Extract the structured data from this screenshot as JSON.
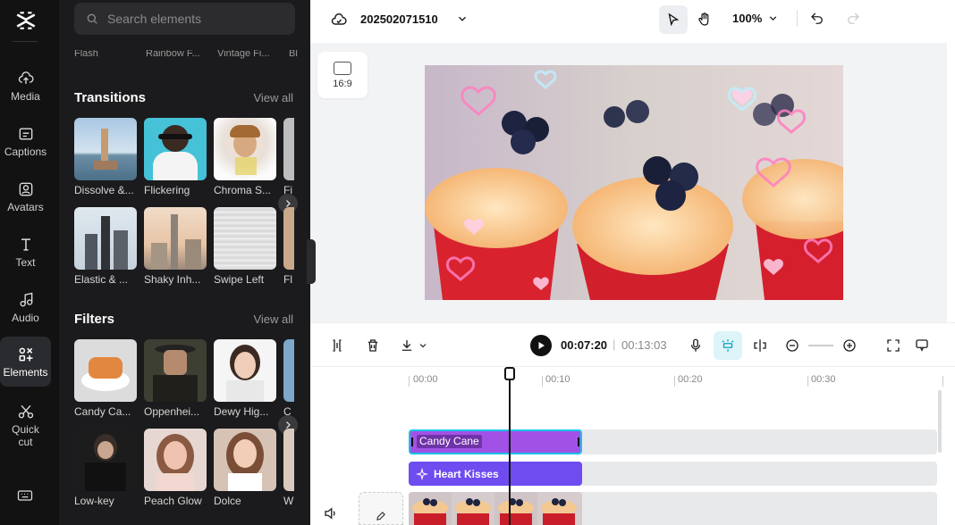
{
  "rail": {
    "items": [
      {
        "label": "Media",
        "icon": "cloud-upload-icon"
      },
      {
        "label": "Captions",
        "icon": "captions-icon"
      },
      {
        "label": "Avatars",
        "icon": "avatar-icon"
      },
      {
        "label": "Text",
        "icon": "text-icon"
      },
      {
        "label": "Audio",
        "icon": "music-icon"
      },
      {
        "label": "Elements",
        "icon": "elements-icon",
        "active": true
      },
      {
        "label": "Quick cut",
        "icon": "scissors-icon"
      }
    ]
  },
  "panel": {
    "search_placeholder": "Search elements",
    "cut_row": [
      "Flash",
      "Rainbow F...",
      "Vintage Fi...",
      "Bl"
    ],
    "transitions": {
      "title": "Transitions",
      "view_all": "View all",
      "row1": [
        "Dissolve &...",
        "Flickering",
        "Chroma S...",
        "Fi"
      ],
      "row2": [
        "Elastic & ...",
        "Shaky Inh...",
        "Swipe Left",
        "Fl"
      ]
    },
    "filters": {
      "title": "Filters",
      "view_all": "View all",
      "row1": [
        "Candy Ca...",
        "Oppenhei...",
        "Dewy Hig...",
        "C"
      ],
      "row2": [
        "Low-key",
        "Peach Glow",
        "Dolce",
        "W"
      ]
    }
  },
  "topbar": {
    "project_name": "202502071510",
    "zoom": "100%"
  },
  "canvas": {
    "aspect_ratio": "16:9"
  },
  "timeline_bar": {
    "current_time": "00:07:20",
    "separator": "|",
    "total_time": "00:13:03"
  },
  "timeline": {
    "ruler": [
      "00:00",
      "00:10",
      "00:20",
      "00:30"
    ],
    "clips": {
      "effect": "Candy Cane",
      "overlay": "Heart Kisses"
    }
  },
  "colors": {
    "accent_effect": "#a251e6",
    "accent_overlay": "#6e4cf0",
    "selection": "#18c2e8"
  }
}
